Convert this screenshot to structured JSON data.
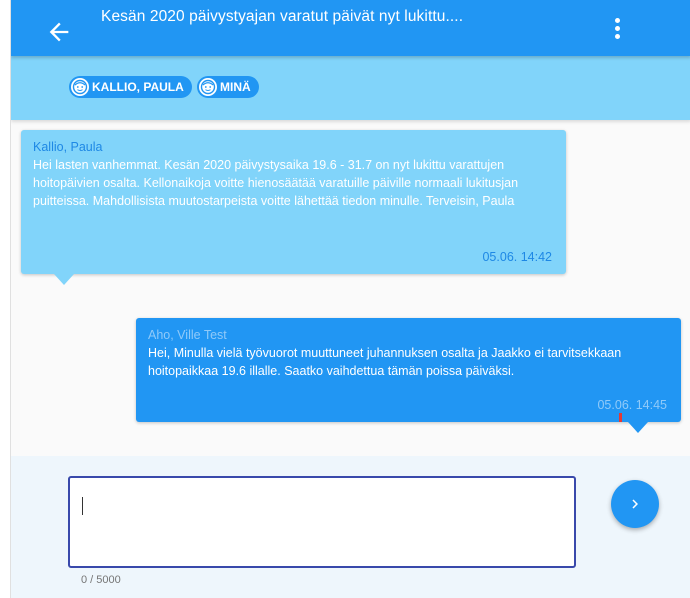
{
  "header": {
    "title": "Kesän 2020 päivystyajan varatut päivät nyt lukittu....",
    "back_icon": "arrow-left-icon",
    "menu_icon": "more-vert-icon"
  },
  "participants": [
    {
      "name": "KALLIO, PAULA",
      "icon": "child-face-icon"
    },
    {
      "name": "MINÄ",
      "icon": "child-face-icon"
    }
  ],
  "messages": [
    {
      "sender": "Kallio, Paula",
      "body": "Hei lasten vanhemmat. Kesän 2020 päivystysaika 19.6 - 31.7 on nyt lukittu varattujen hoitopäivien osalta. Kellonaikoja voitte hienosäätää varatuille päiville normaali lukitusjan puitteissa. Mahdollisista muutostarpeista voitte lähettää tiedon minulle. Terveisin, Paula",
      "time": "05.06. 14:42"
    },
    {
      "sender": "Aho, Ville Test",
      "body": "Hei, Minulla vielä työvuorot muuttuneet juhannuksen osalta ja Jaakko ei tarvitsekkaan hoitopaikkaa 19.6 illalle. Saatko vaihdettua tämän poissa päiväksi.",
      "time": "05.06. 14:45"
    }
  ],
  "composer": {
    "value": "",
    "counter": "0 / 5000",
    "send_icon": "chevron-right-icon"
  },
  "colors": {
    "primary": "#2196f3",
    "light": "#81d4fa",
    "input_border": "#3949ab"
  }
}
